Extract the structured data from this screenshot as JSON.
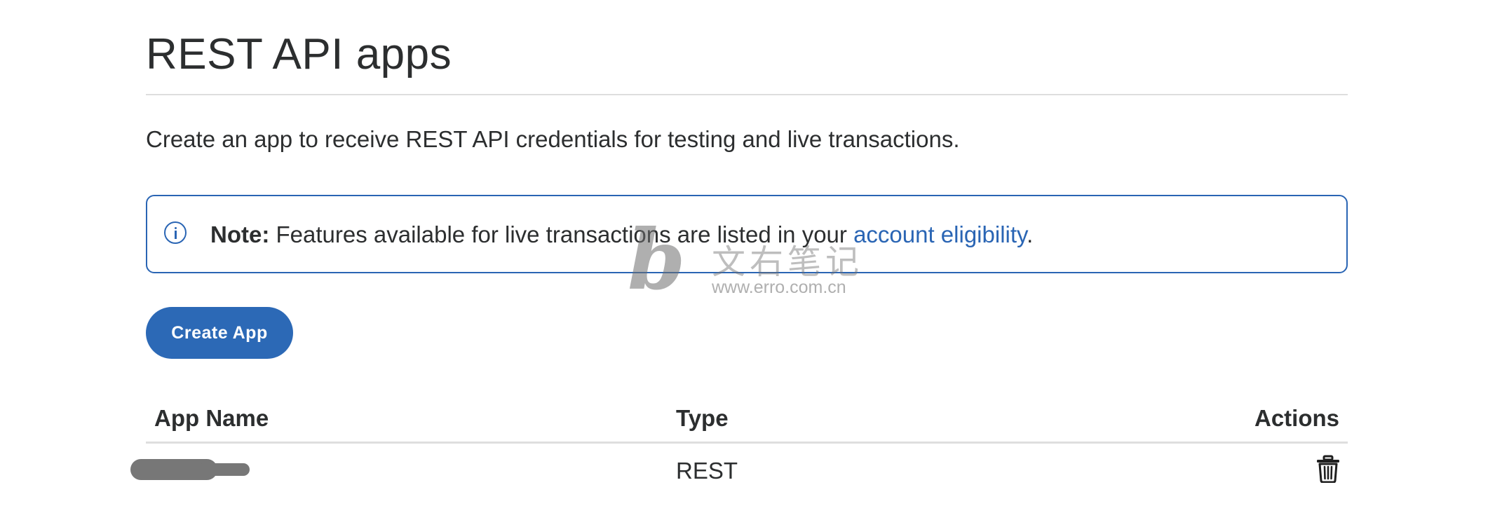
{
  "page": {
    "title": "REST API apps",
    "description": "Create an app to receive REST API credentials for testing and live transactions."
  },
  "note": {
    "label": "Note:",
    "text": " Features available for live transactions are listed in your ",
    "link": "account eligibility",
    "suffix": "."
  },
  "actions": {
    "create_label": "Create App"
  },
  "table": {
    "headers": {
      "name": "App Name",
      "type": "Type",
      "actions": "Actions"
    },
    "rows": [
      {
        "name": "",
        "type": "REST"
      }
    ]
  },
  "watermark": {
    "title": "文右笔记",
    "url": "www.erro.com.cn"
  },
  "colors": {
    "accent": "#2a65b4",
    "button": "#2c69b6",
    "text": "#2c2e2f",
    "divider": "#dedede"
  }
}
